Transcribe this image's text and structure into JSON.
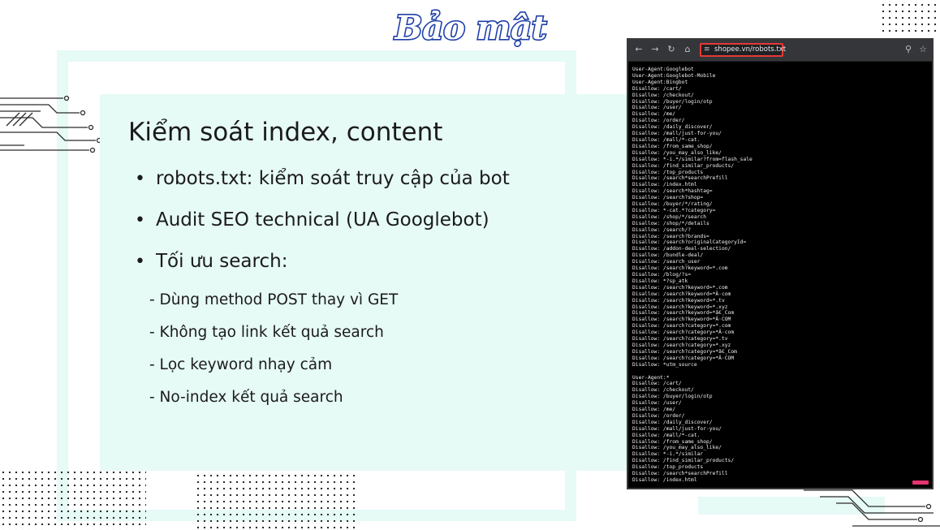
{
  "logo": {
    "text": "Bảo mật"
  },
  "slide": {
    "title": "Kiểm soát index, content",
    "bullets": [
      "robots.txt: kiểm soát truy cập của bot",
      "Audit SEO technical (UA Googlebot)",
      "Tối ưu search:"
    ],
    "sub_bullets": [
      "- Dùng method POST thay vì GET",
      "- Không tạo link kết quả search",
      "- Lọc keyword nhạy cảm",
      "- No-index kết quả search"
    ]
  },
  "browser": {
    "url": "shopee.vn/robots.txt",
    "icons": [
      "back-arrow-icon",
      "forward-arrow-icon",
      "reload-icon",
      "home-icon",
      "site-info-icon",
      "search-icon",
      "bookmark-star-icon"
    ],
    "robots_lines": [
      "User-Agent:Googlebot",
      "User-Agent:Googlebot-Mobile",
      "User-Agent:Bingbot",
      "Disallow: /cart/",
      "Disallow: /checkout/",
      "Disallow: /buyer/login/otp",
      "Disallow: /user/",
      "Disallow: /me/",
      "Disallow: /order/",
      "Disallow: /daily_discover/",
      "Disallow: /mall/just-for-you/",
      "Disallow: /mall/*-cat.",
      "Disallow: /from_same_shop/",
      "Disallow: /you_may_also_like/",
      "Disallow: *-i.*/similar?from=flash_sale",
      "Disallow: /find_similar_products/",
      "Disallow: /top_products",
      "Disallow: /search*searchPrefill",
      "Disallow: /index.html",
      "Disallow: /search*hashtag=",
      "Disallow: /search?shop=",
      "Disallow: /buyer/*/rating/",
      "Disallow: *-cat.*?category=",
      "Disallow: /shop/*/search",
      "Disallow: /shop/*/details",
      "Disallow: /search/?",
      "Disallow: /search?brands=",
      "Disallow: /search?originalCategoryId=",
      "Disallow: /addon-deal-selection/",
      "Disallow: /bundle-deal/",
      "Disallow: /search_user",
      "Disallow: /search?keyword=*.com",
      "Disallow: /blog/?s=",
      "Disallow: *?sp_atk",
      "Disallow: /search?keyword=*.com",
      "Disallow: /search?keyword=*Â·com",
      "Disallow: /search?keyword=*.tv",
      "Disallow: /search?keyword=*.xyz",
      "Disallow: /search?keyword=*â€¸Com",
      "Disallow: /search?keyword=*Â·COM",
      "Disallow: /search?category=*.com",
      "Disallow: /search?category=*Â·com",
      "Disallow: /search?category=*.tv",
      "Disallow: /search?category=*.xyz",
      "Disallow: /search?category=*â€¸Com",
      "Disallow: /search?category=*Â·COM",
      "Disallow: *utm_source",
      "",
      "User-Agent:*",
      "Disallow: /cart/",
      "Disallow: /checkout/",
      "Disallow: /buyer/login/otp",
      "Disallow: /user/",
      "Disallow: /me/",
      "Disallow: /order/",
      "Disallow: /daily_discover/",
      "Disallow: /mall/just-for-you/",
      "Disallow: /mall/*-cat.",
      "Disallow: /from_same_shop/",
      "Disallow: /you_may_also_like/",
      "Disallow: *-i.*/similar",
      "Disallow: /find_similar_products/",
      "Disallow: /top_products",
      "Disallow: /search*searchPrefill",
      "Disallow: /index.html"
    ]
  },
  "colors": {
    "panel_bg": "#e6faf6",
    "logo_fill": "#ffffff",
    "logo_outline": "#1f3fa8",
    "addr_highlight": "#e53935"
  }
}
